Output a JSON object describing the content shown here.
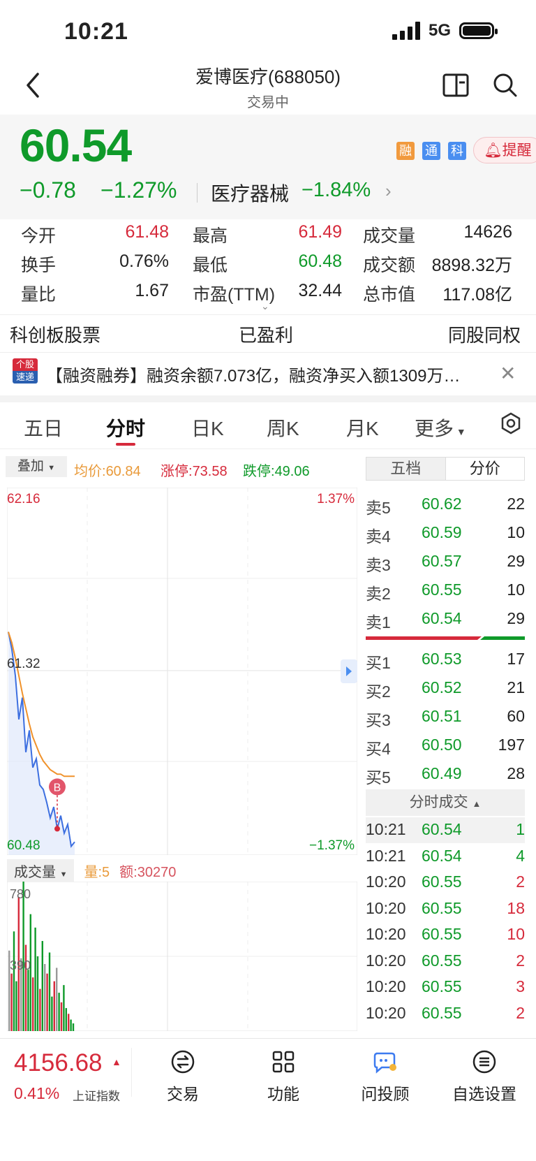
{
  "status": {
    "time": "10:21",
    "network": "5G"
  },
  "header": {
    "title": "爱博医疗(688050)",
    "subtitle": "交易中"
  },
  "quote": {
    "price": "60.54",
    "change": "−0.78",
    "change_pct": "−1.27%",
    "sector": "医疗器械",
    "sector_pct": "−1.84%",
    "badges": [
      "融",
      "通",
      "科"
    ],
    "alert_label": "提醒"
  },
  "stats": {
    "open": {
      "label": "今开",
      "value": "61.48"
    },
    "high": {
      "label": "最高",
      "value": "61.49"
    },
    "volume": {
      "label": "成交量",
      "value": "14626"
    },
    "turnover": {
      "label": "换手",
      "value": "0.76%"
    },
    "low": {
      "label": "最低",
      "value": "60.48"
    },
    "amount": {
      "label": "成交额",
      "value": "8898.32万"
    },
    "vol_ratio": {
      "label": "量比",
      "value": "1.67"
    },
    "pe": {
      "label": "市盈(TTM)",
      "value": "32.44"
    },
    "market_cap": {
      "label": "总市值",
      "value": "117.08亿"
    }
  },
  "tags": [
    "科创板股票",
    "已盈利",
    "同股同权"
  ],
  "news": {
    "logo_top": "个股",
    "logo_bottom": "速递",
    "text": "【融资融券】融资余额7.073亿，融资净买入额1309万…"
  },
  "chart_tabs": [
    "五日",
    "分时",
    "日K",
    "周K",
    "月K",
    "更多"
  ],
  "chart_header": {
    "overlay": "叠加",
    "avg_label": "均价:",
    "avg": "60.84",
    "limit_up_label": "涨停:",
    "limit_up": "73.58",
    "limit_down_label": "跌停:",
    "limit_down": "49.06"
  },
  "panel_tabs": [
    "五档",
    "分价"
  ],
  "chart_data": {
    "type": "line",
    "y_ticks_left": [
      "62.16",
      "61.32",
      "60.48"
    ],
    "y_ticks_right": [
      "1.37%",
      "−1.37%"
    ],
    "ylim": [
      60.48,
      62.16
    ],
    "marker": "B",
    "series": [
      {
        "values": [
          61.5,
          61.42,
          61.3,
          61.1,
          61.2,
          60.95,
          61.05,
          60.88,
          60.92,
          60.8,
          60.78,
          60.72,
          60.65,
          60.7,
          60.6,
          60.66,
          60.58,
          60.62,
          60.52,
          60.54
        ]
      },
      {
        "values": [
          61.5,
          61.45,
          61.38,
          61.3,
          61.22,
          61.15,
          61.08,
          61.02,
          60.98,
          60.94,
          60.91,
          60.89,
          60.87,
          60.86,
          60.85,
          60.85,
          60.84,
          60.84,
          60.84,
          60.84
        ]
      }
    ],
    "volume": {
      "label": "成交量",
      "qty_label": "量:",
      "qty": "5",
      "amt_label": "额:",
      "amt": "30270",
      "y_ticks": [
        "780",
        "390"
      ],
      "values": [
        420,
        300,
        520,
        260,
        700,
        380,
        780,
        450,
        320,
        610,
        280,
        540,
        390,
        220,
        470,
        350,
        300,
        410,
        180,
        260,
        330,
        200,
        150,
        240,
        120,
        90,
        60,
        40
      ]
    }
  },
  "order_book": {
    "asks": [
      {
        "label": "卖5",
        "price": "60.62",
        "vol": "22"
      },
      {
        "label": "卖4",
        "price": "60.59",
        "vol": "10"
      },
      {
        "label": "卖3",
        "price": "60.57",
        "vol": "29"
      },
      {
        "label": "卖2",
        "price": "60.55",
        "vol": "10"
      },
      {
        "label": "卖1",
        "price": "60.54",
        "vol": "29"
      }
    ],
    "bids": [
      {
        "label": "买1",
        "price": "60.53",
        "vol": "17"
      },
      {
        "label": "买2",
        "price": "60.52",
        "vol": "21"
      },
      {
        "label": "买3",
        "price": "60.51",
        "vol": "60"
      },
      {
        "label": "买4",
        "price": "60.50",
        "vol": "197"
      },
      {
        "label": "买5",
        "price": "60.49",
        "vol": "28"
      }
    ]
  },
  "ticks": {
    "header": "分时成交",
    "rows": [
      {
        "time": "10:21",
        "price": "60.54",
        "vol": "1"
      },
      {
        "time": "10:21",
        "price": "60.54",
        "vol": "4"
      },
      {
        "time": "10:20",
        "price": "60.55",
        "vol": "2"
      },
      {
        "time": "10:20",
        "price": "60.55",
        "vol": "18"
      },
      {
        "time": "10:20",
        "price": "60.55",
        "vol": "10"
      },
      {
        "time": "10:20",
        "price": "60.55",
        "vol": "2"
      },
      {
        "time": "10:20",
        "price": "60.55",
        "vol": "3"
      },
      {
        "time": "10:20",
        "price": "60.55",
        "vol": "2"
      }
    ]
  },
  "bottom": {
    "index_value": "4156.68",
    "index_pct": "0.41%",
    "index_name": "上证指数",
    "nav": [
      "交易",
      "功能",
      "问投顾",
      "自选设置"
    ]
  }
}
